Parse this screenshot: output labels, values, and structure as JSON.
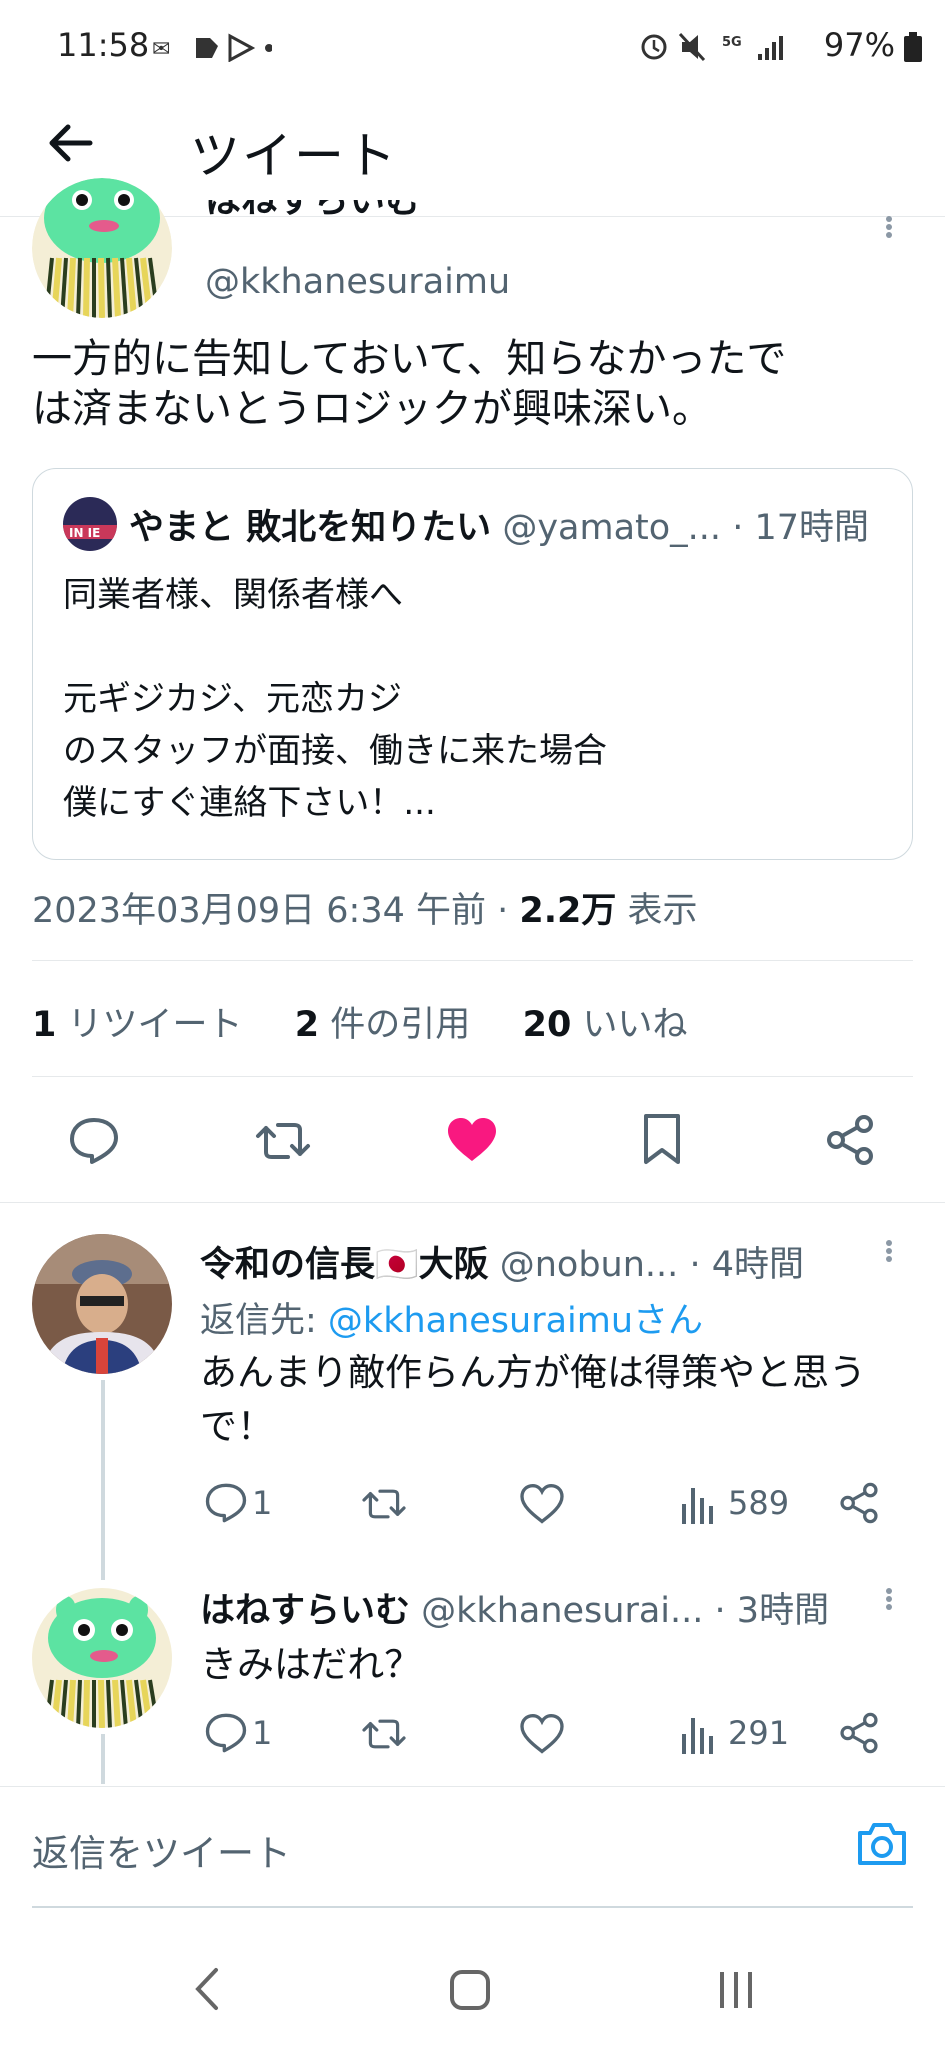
{
  "status_bar": {
    "time": "11:58",
    "battery": "97%",
    "network": "5G"
  },
  "header": {
    "title": "ツイート"
  },
  "main_tweet": {
    "display_name": "はねすらいむ",
    "handle": "@kkhanesuraimu",
    "text_line1": "一方的に告知しておいて、知らなかったで",
    "text_line2": "は済まないとうロジックが興味深い。",
    "quoted": {
      "display_name": "やまと 敗北を知りたい",
      "handle": "@yamato_...",
      "time": "· 17時間",
      "line1": "同業者様、関係者様へ",
      "line2": "元ギジカジ、元恋カジ",
      "line3": "のスタッフが面接、働きに来た場合",
      "line4": "僕にすぐ連絡下さい！..."
    },
    "timestamp": "2023年03月09日 6:34 午前 · ",
    "views_count": "2.2万",
    "views_label": "表示",
    "stats": {
      "retweets_count": "1",
      "retweets_label": "リツイート",
      "quotes_count": "2",
      "quotes_label": "件の引用",
      "likes_count": "20",
      "likes_label": "いいね"
    }
  },
  "replies": [
    {
      "display_name": "令和の信長🇯🇵大阪",
      "handle": "@nobun...",
      "time": "· 4時間",
      "reply_to_label": "返信先: ",
      "reply_to_user": "@kkhanesuraimuさん",
      "text_line1": "あんまり敵作らん方が俺は得策やと思う",
      "text_line2": "で！",
      "reply_count": "1",
      "views": "589"
    },
    {
      "display_name": "はねすらいむ",
      "handle": "@kkhanesurai...",
      "time": "· 3時間",
      "text_line1": "きみはだれ？",
      "reply_count": "1",
      "views": "291"
    }
  ],
  "compose": {
    "placeholder": "返信をツイート"
  },
  "colors": {
    "accent": "#1d9bf0",
    "like": "#f91880",
    "text": "#0f1419",
    "secondary": "#536471"
  }
}
